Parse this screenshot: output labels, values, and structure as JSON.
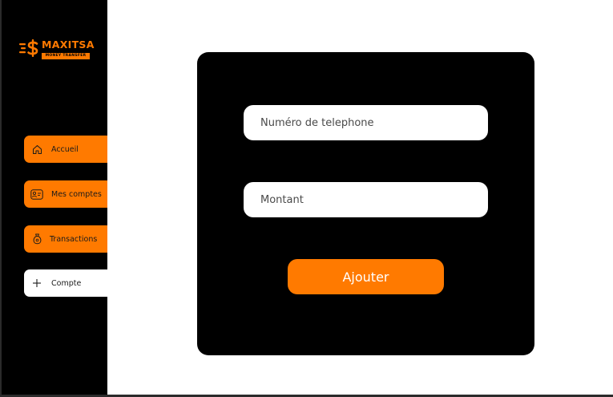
{
  "brand": {
    "name": "MAXITSA",
    "tagline": "MONEY TRANSFER",
    "accent_color": "#ff7a00"
  },
  "sidebar": {
    "items": [
      {
        "label": "Accueil",
        "icon": "home-icon"
      },
      {
        "label": "Mes comptes",
        "icon": "id-card-icon"
      },
      {
        "label": "Transactions",
        "icon": "money-bag-icon"
      },
      {
        "label": "Compte",
        "icon": "plus-icon"
      }
    ]
  },
  "form": {
    "phone_placeholder": "Numéro de telephone",
    "phone_value": "",
    "amount_placeholder": "Montant",
    "amount_value": "",
    "submit_label": "Ajouter"
  }
}
